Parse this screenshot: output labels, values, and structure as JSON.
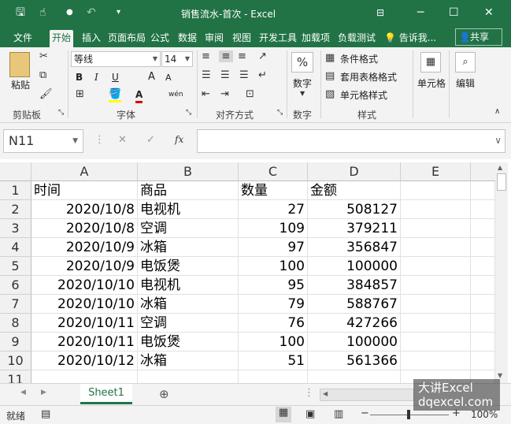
{
  "window": {
    "title": "销售流水-首次 - Excel",
    "qat": {
      "save_icon": "save-icon",
      "touch_icon": "touch-mode-icon",
      "undo_icon": "undo-icon",
      "customize_icon": "customize-qat-icon"
    },
    "controls": {
      "ribbon_display_icon": "ribbon-display-icon",
      "minimize": "─",
      "maximize": "☐",
      "close": "✕"
    }
  },
  "tabs": [
    "文件",
    "开始",
    "插入",
    "页面布局",
    "公式",
    "数据",
    "审阅",
    "视图",
    "开发工具",
    "加载项",
    "负载测试"
  ],
  "active_tab": "开始",
  "tell_me": "告诉我...",
  "share": "共享",
  "ribbon": {
    "clipboard": {
      "group": "剪贴板",
      "paste": "粘贴"
    },
    "font": {
      "group": "字体",
      "name": "等线",
      "size": "14",
      "bold": "B",
      "italic": "I",
      "underline": "U",
      "grow": "A",
      "shrink": "A",
      "wen": "wén"
    },
    "alignment": {
      "group": "对齐方式"
    },
    "number": {
      "group": "数字",
      "label": "数字",
      "percent": "%"
    },
    "styles": {
      "group": "样式",
      "conditional": "条件格式",
      "table": "套用表格格式",
      "cell": "单元格样式"
    },
    "cells": {
      "label": "单元格"
    },
    "editing": {
      "label": "编辑"
    }
  },
  "formula_bar": {
    "name_box": "N11",
    "fx": "fx",
    "value": ""
  },
  "columns": [
    "A",
    "B",
    "C",
    "D",
    "E"
  ],
  "rows": [
    "1",
    "2",
    "3",
    "4",
    "5",
    "6",
    "7",
    "8",
    "9",
    "10",
    "11"
  ],
  "cells": [
    [
      "时间",
      "商品",
      "数量",
      "金额"
    ],
    [
      "2020/10/8",
      "电视机",
      "27",
      "508127"
    ],
    [
      "2020/10/8",
      "空调",
      "109",
      "379211"
    ],
    [
      "2020/10/9",
      "冰箱",
      "97",
      "356847"
    ],
    [
      "2020/10/9",
      "电饭煲",
      "100",
      "100000"
    ],
    [
      "2020/10/10",
      "电视机",
      "95",
      "384857"
    ],
    [
      "2020/10/10",
      "冰箱",
      "79",
      "588767"
    ],
    [
      "2020/10/11",
      "空调",
      "76",
      "427266"
    ],
    [
      "2020/10/11",
      "电饭煲",
      "100",
      "100000"
    ],
    [
      "2020/10/12",
      "冰箱",
      "51",
      "561366"
    ]
  ],
  "sheet_tab": "Sheet1",
  "status": {
    "ready": "就绪",
    "zoom": "100%"
  },
  "watermark": {
    "line1": "大讲Excel",
    "line2": "dqexcel.com"
  },
  "accent": "#217346"
}
